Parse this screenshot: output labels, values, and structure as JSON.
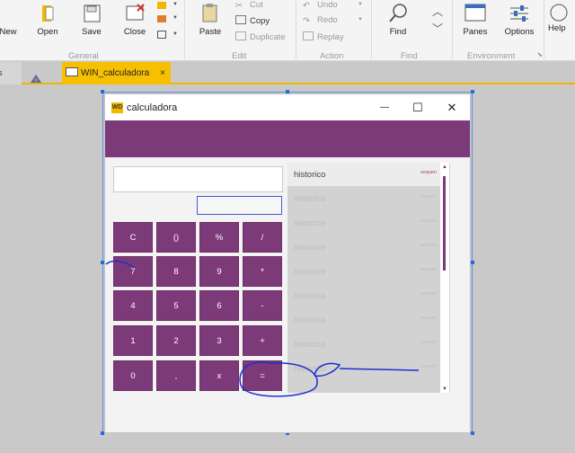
{
  "ribbon": {
    "new_label": "New",
    "open_label": "Open",
    "save_label": "Save",
    "close_label": "Close",
    "paste_label": "Paste",
    "cut_label": "Cut",
    "copy_label": "Copy",
    "duplicate_label": "Duplicate",
    "undo_label": "Undo",
    "redo_label": "Redo",
    "replay_label": "Replay",
    "find_label": "Find",
    "panes_label": "Panes",
    "options_label": "Options",
    "help_label": "Help",
    "group_general": "General",
    "group_edit": "Edit",
    "group_action": "Action",
    "group_find": "Find",
    "group_environment": "Environment"
  },
  "tabs": {
    "active_label": "WIN_calculadora",
    "close_glyph": "×"
  },
  "window": {
    "logo_text": "WD",
    "title": "calculadora",
    "minimize_glyph": "—",
    "maximize_glyph": "☐",
    "close_glyph": "✕"
  },
  "keys": [
    {
      "label": "C"
    },
    {
      "label": "()"
    },
    {
      "label": "%"
    },
    {
      "label": "/"
    },
    {
      "label": "7"
    },
    {
      "label": "8"
    },
    {
      "label": "9"
    },
    {
      "label": "*"
    },
    {
      "label": "4"
    },
    {
      "label": "5"
    },
    {
      "label": "6"
    },
    {
      "label": "-"
    },
    {
      "label": "1"
    },
    {
      "label": "2"
    },
    {
      "label": "3"
    },
    {
      "label": "+"
    },
    {
      "label": "0"
    },
    {
      "label": ","
    },
    {
      "label": "x"
    },
    {
      "label": "="
    }
  ],
  "history": {
    "items": [
      {
        "text": "historico",
        "seq": "sequen"
      },
      {
        "text": "historico",
        "seq": "sequen"
      },
      {
        "text": "historico",
        "seq": "sequen"
      },
      {
        "text": "historico",
        "seq": "sequen"
      },
      {
        "text": "historico",
        "seq": "sequen"
      },
      {
        "text": "historico",
        "seq": "sequen"
      },
      {
        "text": "historico",
        "seq": "sequen"
      },
      {
        "text": "historico",
        "seq": "sequen"
      },
      {
        "text": "historico",
        "seq": "sequen"
      }
    ]
  },
  "colors": {
    "accent": "#7d3a78",
    "tab_active": "#f6c000",
    "annotation": "#1f2fd0"
  }
}
